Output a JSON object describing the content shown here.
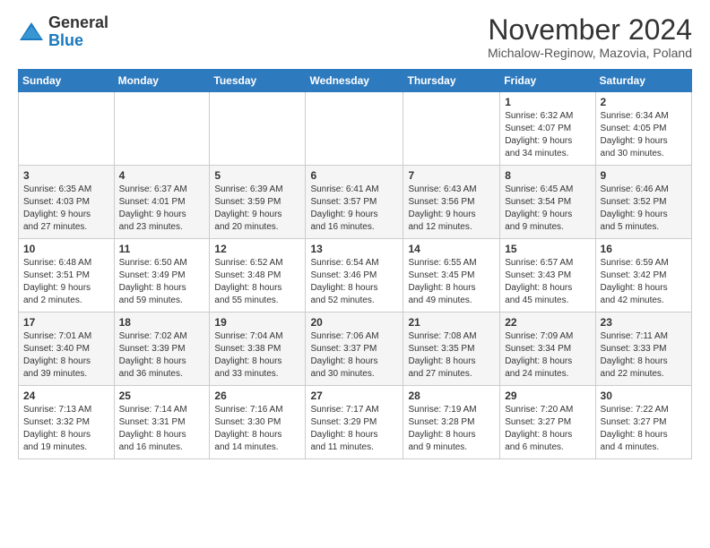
{
  "header": {
    "logo_general": "General",
    "logo_blue": "Blue",
    "month_title": "November 2024",
    "location": "Michalow-Reginow, Mazovia, Poland"
  },
  "weekdays": [
    "Sunday",
    "Monday",
    "Tuesday",
    "Wednesday",
    "Thursday",
    "Friday",
    "Saturday"
  ],
  "weeks": [
    [
      {
        "day": "",
        "info": ""
      },
      {
        "day": "",
        "info": ""
      },
      {
        "day": "",
        "info": ""
      },
      {
        "day": "",
        "info": ""
      },
      {
        "day": "",
        "info": ""
      },
      {
        "day": "1",
        "info": "Sunrise: 6:32 AM\nSunset: 4:07 PM\nDaylight: 9 hours\nand 34 minutes."
      },
      {
        "day": "2",
        "info": "Sunrise: 6:34 AM\nSunset: 4:05 PM\nDaylight: 9 hours\nand 30 minutes."
      }
    ],
    [
      {
        "day": "3",
        "info": "Sunrise: 6:35 AM\nSunset: 4:03 PM\nDaylight: 9 hours\nand 27 minutes."
      },
      {
        "day": "4",
        "info": "Sunrise: 6:37 AM\nSunset: 4:01 PM\nDaylight: 9 hours\nand 23 minutes."
      },
      {
        "day": "5",
        "info": "Sunrise: 6:39 AM\nSunset: 3:59 PM\nDaylight: 9 hours\nand 20 minutes."
      },
      {
        "day": "6",
        "info": "Sunrise: 6:41 AM\nSunset: 3:57 PM\nDaylight: 9 hours\nand 16 minutes."
      },
      {
        "day": "7",
        "info": "Sunrise: 6:43 AM\nSunset: 3:56 PM\nDaylight: 9 hours\nand 12 minutes."
      },
      {
        "day": "8",
        "info": "Sunrise: 6:45 AM\nSunset: 3:54 PM\nDaylight: 9 hours\nand 9 minutes."
      },
      {
        "day": "9",
        "info": "Sunrise: 6:46 AM\nSunset: 3:52 PM\nDaylight: 9 hours\nand 5 minutes."
      }
    ],
    [
      {
        "day": "10",
        "info": "Sunrise: 6:48 AM\nSunset: 3:51 PM\nDaylight: 9 hours\nand 2 minutes."
      },
      {
        "day": "11",
        "info": "Sunrise: 6:50 AM\nSunset: 3:49 PM\nDaylight: 8 hours\nand 59 minutes."
      },
      {
        "day": "12",
        "info": "Sunrise: 6:52 AM\nSunset: 3:48 PM\nDaylight: 8 hours\nand 55 minutes."
      },
      {
        "day": "13",
        "info": "Sunrise: 6:54 AM\nSunset: 3:46 PM\nDaylight: 8 hours\nand 52 minutes."
      },
      {
        "day": "14",
        "info": "Sunrise: 6:55 AM\nSunset: 3:45 PM\nDaylight: 8 hours\nand 49 minutes."
      },
      {
        "day": "15",
        "info": "Sunrise: 6:57 AM\nSunset: 3:43 PM\nDaylight: 8 hours\nand 45 minutes."
      },
      {
        "day": "16",
        "info": "Sunrise: 6:59 AM\nSunset: 3:42 PM\nDaylight: 8 hours\nand 42 minutes."
      }
    ],
    [
      {
        "day": "17",
        "info": "Sunrise: 7:01 AM\nSunset: 3:40 PM\nDaylight: 8 hours\nand 39 minutes."
      },
      {
        "day": "18",
        "info": "Sunrise: 7:02 AM\nSunset: 3:39 PM\nDaylight: 8 hours\nand 36 minutes."
      },
      {
        "day": "19",
        "info": "Sunrise: 7:04 AM\nSunset: 3:38 PM\nDaylight: 8 hours\nand 33 minutes."
      },
      {
        "day": "20",
        "info": "Sunrise: 7:06 AM\nSunset: 3:37 PM\nDaylight: 8 hours\nand 30 minutes."
      },
      {
        "day": "21",
        "info": "Sunrise: 7:08 AM\nSunset: 3:35 PM\nDaylight: 8 hours\nand 27 minutes."
      },
      {
        "day": "22",
        "info": "Sunrise: 7:09 AM\nSunset: 3:34 PM\nDaylight: 8 hours\nand 24 minutes."
      },
      {
        "day": "23",
        "info": "Sunrise: 7:11 AM\nSunset: 3:33 PM\nDaylight: 8 hours\nand 22 minutes."
      }
    ],
    [
      {
        "day": "24",
        "info": "Sunrise: 7:13 AM\nSunset: 3:32 PM\nDaylight: 8 hours\nand 19 minutes."
      },
      {
        "day": "25",
        "info": "Sunrise: 7:14 AM\nSunset: 3:31 PM\nDaylight: 8 hours\nand 16 minutes."
      },
      {
        "day": "26",
        "info": "Sunrise: 7:16 AM\nSunset: 3:30 PM\nDaylight: 8 hours\nand 14 minutes."
      },
      {
        "day": "27",
        "info": "Sunrise: 7:17 AM\nSunset: 3:29 PM\nDaylight: 8 hours\nand 11 minutes."
      },
      {
        "day": "28",
        "info": "Sunrise: 7:19 AM\nSunset: 3:28 PM\nDaylight: 8 hours\nand 9 minutes."
      },
      {
        "day": "29",
        "info": "Sunrise: 7:20 AM\nSunset: 3:27 PM\nDaylight: 8 hours\nand 6 minutes."
      },
      {
        "day": "30",
        "info": "Sunrise: 7:22 AM\nSunset: 3:27 PM\nDaylight: 8 hours\nand 4 minutes."
      }
    ]
  ]
}
